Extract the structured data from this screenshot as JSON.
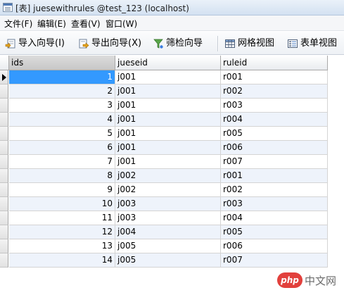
{
  "window": {
    "title": "[表] juesewithrules @test_123 (localhost)"
  },
  "menu": [
    {
      "label": "文件(F)"
    },
    {
      "label": "编辑(E)"
    },
    {
      "label": "查看(V)"
    },
    {
      "label": "窗口(W)"
    }
  ],
  "toolbar": {
    "import_label": "导入向导(I)",
    "export_label": "导出向导(X)",
    "filter_label": "筛检向导",
    "grid_view_label": "网格视图",
    "form_view_label": "表单视图"
  },
  "columns": [
    "ids",
    "jueseid",
    "ruleid"
  ],
  "rows": [
    {
      "ids": "1",
      "jueseid": "j001",
      "ruleid": "r001"
    },
    {
      "ids": "2",
      "jueseid": "j001",
      "ruleid": "r002"
    },
    {
      "ids": "3",
      "jueseid": "j001",
      "ruleid": "r003"
    },
    {
      "ids": "4",
      "jueseid": "j001",
      "ruleid": "r004"
    },
    {
      "ids": "5",
      "jueseid": "j001",
      "ruleid": "r005"
    },
    {
      "ids": "6",
      "jueseid": "j001",
      "ruleid": "r006"
    },
    {
      "ids": "7",
      "jueseid": "j001",
      "ruleid": "r007"
    },
    {
      "ids": "8",
      "jueseid": "j002",
      "ruleid": "r001"
    },
    {
      "ids": "9",
      "jueseid": "j002",
      "ruleid": "r002"
    },
    {
      "ids": "10",
      "jueseid": "j003",
      "ruleid": "r003"
    },
    {
      "ids": "11",
      "jueseid": "j003",
      "ruleid": "r004"
    },
    {
      "ids": "12",
      "jueseid": "j004",
      "ruleid": "r005"
    },
    {
      "ids": "13",
      "jueseid": "j005",
      "ruleid": "r006"
    },
    {
      "ids": "14",
      "jueseid": "j005",
      "ruleid": "r007"
    }
  ],
  "selection": {
    "row": 1,
    "column": "ids"
  },
  "watermark": {
    "badge": "php",
    "text": "中文网"
  },
  "colors": {
    "selection": "#3399ff",
    "alt_row": "#eef3fb",
    "watermark_badge": "#e2403c"
  }
}
